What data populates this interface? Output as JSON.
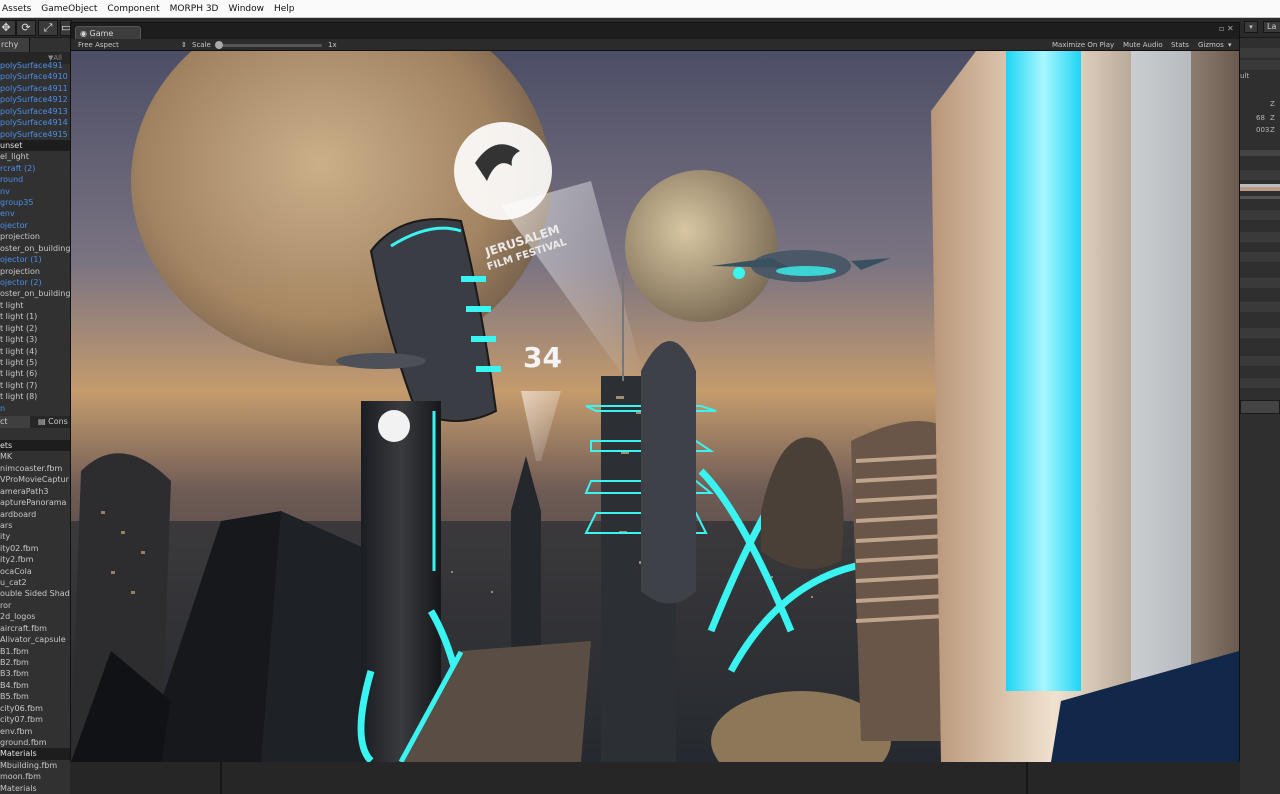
{
  "menubar": {
    "items": [
      "Assets",
      "GameObject",
      "Component",
      "MORPH 3D",
      "Window",
      "Help"
    ]
  },
  "toolbar": {
    "icons": [
      "move-tool-icon",
      "rotate-tool-icon",
      "scale-tool-icon"
    ],
    "right_label": "La"
  },
  "hierarchy": {
    "tab_label": "rchy",
    "search_placeholder": "▼All",
    "rows": [
      {
        "text": "polySurface491",
        "style": "blue"
      },
      {
        "text": "polySurface4910",
        "style": "blue"
      },
      {
        "text": "polySurface4911",
        "style": "blue"
      },
      {
        "text": "polySurface4912",
        "style": "blue"
      },
      {
        "text": "polySurface4913",
        "style": "blue"
      },
      {
        "text": "polySurface4914",
        "style": "blue"
      },
      {
        "text": "polySurface4915",
        "style": "blue"
      },
      {
        "text": "unset",
        "style": "head"
      },
      {
        "text": "el_light",
        "style": "plain"
      },
      {
        "text": "rcraft (2)",
        "style": "blue"
      },
      {
        "text": "round",
        "style": "blue"
      },
      {
        "text": "nv",
        "style": "blue"
      },
      {
        "text": "group35",
        "style": "blue"
      },
      {
        "text": "    env",
        "style": "blue"
      },
      {
        "text": "ojector",
        "style": "blue"
      },
      {
        "text": " projection",
        "style": "plain"
      },
      {
        "text": "oster_on_building",
        "style": "plain"
      },
      {
        "text": "ojector (1)",
        "style": "blue"
      },
      {
        "text": " projection",
        "style": "plain"
      },
      {
        "text": "ojector (2)",
        "style": "blue"
      },
      {
        "text": "oster_on_building",
        "style": "plain"
      },
      {
        "text": "t light",
        "style": "plain"
      },
      {
        "text": "t light (1)",
        "style": "plain"
      },
      {
        "text": "t light (2)",
        "style": "plain"
      },
      {
        "text": "t light (3)",
        "style": "plain"
      },
      {
        "text": "t light (4)",
        "style": "plain"
      },
      {
        "text": "t light (5)",
        "style": "plain"
      },
      {
        "text": "t light (6)",
        "style": "plain"
      },
      {
        "text": "t light (7)",
        "style": "plain"
      },
      {
        "text": "t light (8)",
        "style": "plain"
      },
      {
        "text": "n",
        "style": "blue"
      }
    ]
  },
  "project": {
    "tab_left": "ct",
    "tab_right": "Cons",
    "rows": [
      {
        "text": "ets",
        "style": "head"
      },
      {
        "text": "MK",
        "style": "plain"
      },
      {
        "text": "nimcoaster.fbm",
        "style": "plain"
      },
      {
        "text": "VProMovieCaptur",
        "style": "plain"
      },
      {
        "text": "ameraPath3",
        "style": "plain"
      },
      {
        "text": "apturePanorama",
        "style": "plain"
      },
      {
        "text": "ardboard",
        "style": "plain"
      },
      {
        "text": "ars",
        "style": "plain"
      },
      {
        "text": "ity",
        "style": "plain"
      },
      {
        "text": "ity02.fbm",
        "style": "plain"
      },
      {
        "text": "ity2.fbm",
        "style": "plain"
      },
      {
        "text": "ocaCola",
        "style": "plain"
      },
      {
        "text": "u_cat2",
        "style": "plain"
      },
      {
        "text": "ouble Sided Shad",
        "style": "plain"
      },
      {
        "text": "ror",
        "style": "plain"
      },
      {
        "text": " 2d_logos",
        "style": "plain"
      },
      {
        "text": " aircraft.fbm",
        "style": "plain"
      },
      {
        "text": " Alivator_capsule",
        "style": "plain"
      },
      {
        "text": " B1.fbm",
        "style": "plain"
      },
      {
        "text": " B2.fbm",
        "style": "plain"
      },
      {
        "text": " B3.fbm",
        "style": "plain"
      },
      {
        "text": " B4.fbm",
        "style": "plain"
      },
      {
        "text": " B5.fbm",
        "style": "plain"
      },
      {
        "text": " city06.fbm",
        "style": "plain"
      },
      {
        "text": " city07.fbm",
        "style": "plain"
      },
      {
        "text": " env.fbm",
        "style": "plain"
      },
      {
        "text": " ground.fbm",
        "style": "plain"
      },
      {
        "text": " Materials",
        "style": "head"
      },
      {
        "text": " Mbuilding.fbm",
        "style": "plain"
      },
      {
        "text": " moon.fbm",
        "style": "plain"
      },
      {
        "text": "  Materials",
        "style": "plain"
      }
    ]
  },
  "inspector": {
    "label_ult": "ult",
    "axis_z": "Z",
    "value_68": "68",
    "value_003": "003"
  },
  "game": {
    "tab_label": "Game",
    "aspect": "Free Aspect",
    "scale_label": "Scale",
    "scale_value": "1x",
    "maximize_on_play": "Maximize On Play",
    "mute_audio": "Mute Audio",
    "stats": "Stats",
    "gizmos": "Gizmos",
    "window_controls": "▫ ✕"
  },
  "scene": {
    "festival_line1": "JERUSALEM",
    "festival_line2": "FILM FESTIVAL",
    "edition": "34"
  },
  "colors": {
    "neon": "#39f4f0",
    "hierarchy_link": "#4d8ee8",
    "editor_bg": "#313131"
  }
}
